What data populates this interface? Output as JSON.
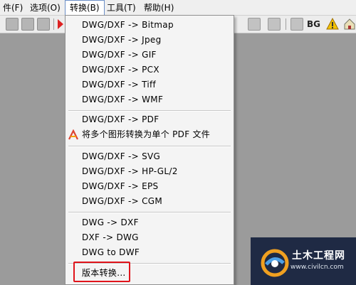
{
  "menubar": {
    "items": [
      {
        "label": "件(F)"
      },
      {
        "label": "选项(O)"
      },
      {
        "label": "转换(B)"
      },
      {
        "label": "工具(T)"
      },
      {
        "label": "帮助(H)"
      }
    ]
  },
  "toolbar": {
    "bg_label": "BG"
  },
  "convert_menu": {
    "groups": [
      [
        "DWG/DXF -> Bitmap",
        "DWG/DXF -> Jpeg",
        "DWG/DXF -> GIF",
        "DWG/DXF -> PCX",
        "DWG/DXF -> Tiff",
        "DWG/DXF -> WMF"
      ],
      [
        "DWG/DXF -> PDF",
        "将多个图形转换为单个 PDF 文件"
      ],
      [
        "DWG/DXF -> SVG",
        "DWG/DXF -> HP-GL/2",
        "DWG/DXF -> EPS",
        "DWG/DXF -> CGM"
      ],
      [
        "DWG -> DXF",
        "DXF -> DWG",
        "DWG to DWF"
      ],
      [
        "版本转换..."
      ]
    ]
  },
  "watermark": {
    "title": "土木工程网",
    "url": "www.civilcn.com"
  },
  "colors": {
    "highlight": "#e0141b",
    "menu_bg": "#f4f4f4",
    "workspace": "#9b9b9b"
  }
}
